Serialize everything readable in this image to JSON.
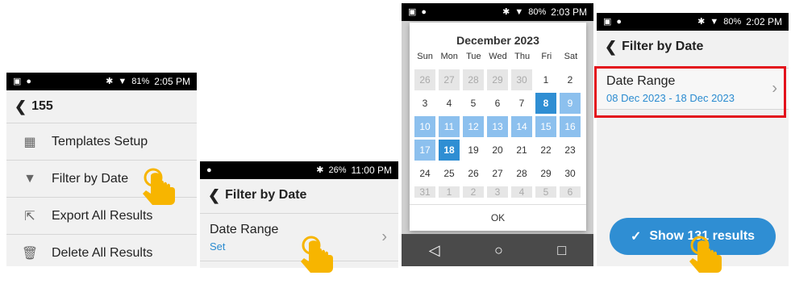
{
  "screen1": {
    "status": {
      "icons_left": [
        "sim-icon",
        "notification-icon"
      ],
      "battery": "81%",
      "time": "2:05 PM"
    },
    "title": "155",
    "items": [
      {
        "icon": "grid-icon",
        "label": "Templates Setup"
      },
      {
        "icon": "filter-icon",
        "label": "Filter by Date"
      },
      {
        "icon": "export-icon",
        "label": "Export All Results"
      },
      {
        "icon": "trash-icon",
        "label": "Delete All Results"
      }
    ]
  },
  "screen2": {
    "status": {
      "battery": "26%",
      "time": "11:00 PM"
    },
    "title": "Filter by Date",
    "date_range": {
      "label": "Date Range",
      "value": "Set"
    }
  },
  "screen3": {
    "status": {
      "battery": "80%",
      "time": "2:03 PM"
    },
    "month_title": "December 2023",
    "weekdays": [
      "Sun",
      "Mon",
      "Tue",
      "Wed",
      "Thu",
      "Fri",
      "Sat"
    ],
    "weeks": [
      [
        "26",
        "27",
        "28",
        "29",
        "30",
        "1",
        "2"
      ],
      [
        "3",
        "4",
        "5",
        "6",
        "7",
        "8",
        "9"
      ],
      [
        "10",
        "11",
        "12",
        "13",
        "14",
        "15",
        "16"
      ],
      [
        "17",
        "18",
        "19",
        "20",
        "21",
        "22",
        "23"
      ],
      [
        "24",
        "25",
        "26",
        "27",
        "28",
        "29",
        "30"
      ],
      [
        "31",
        "1",
        "2",
        "3",
        "4",
        "5",
        "6"
      ]
    ],
    "ok_label": "OK",
    "nav": {
      "back": "◁",
      "home": "○",
      "recents": "□"
    }
  },
  "screen4": {
    "status": {
      "battery": "80%",
      "time": "2:02 PM"
    },
    "title": "Filter by Date",
    "date_range": {
      "label": "Date Range",
      "value": "08 Dec 2023 - 18 Dec 2023"
    },
    "show_button": "Show 131 results",
    "check_glyph": "✓"
  },
  "colors": {
    "accent": "#2f8ed3",
    "range_fill": "#8cc0ee",
    "selected_fill": "#2f8ed3",
    "highlight_border": "#e3121c",
    "hand_fill": "#f7b500"
  }
}
